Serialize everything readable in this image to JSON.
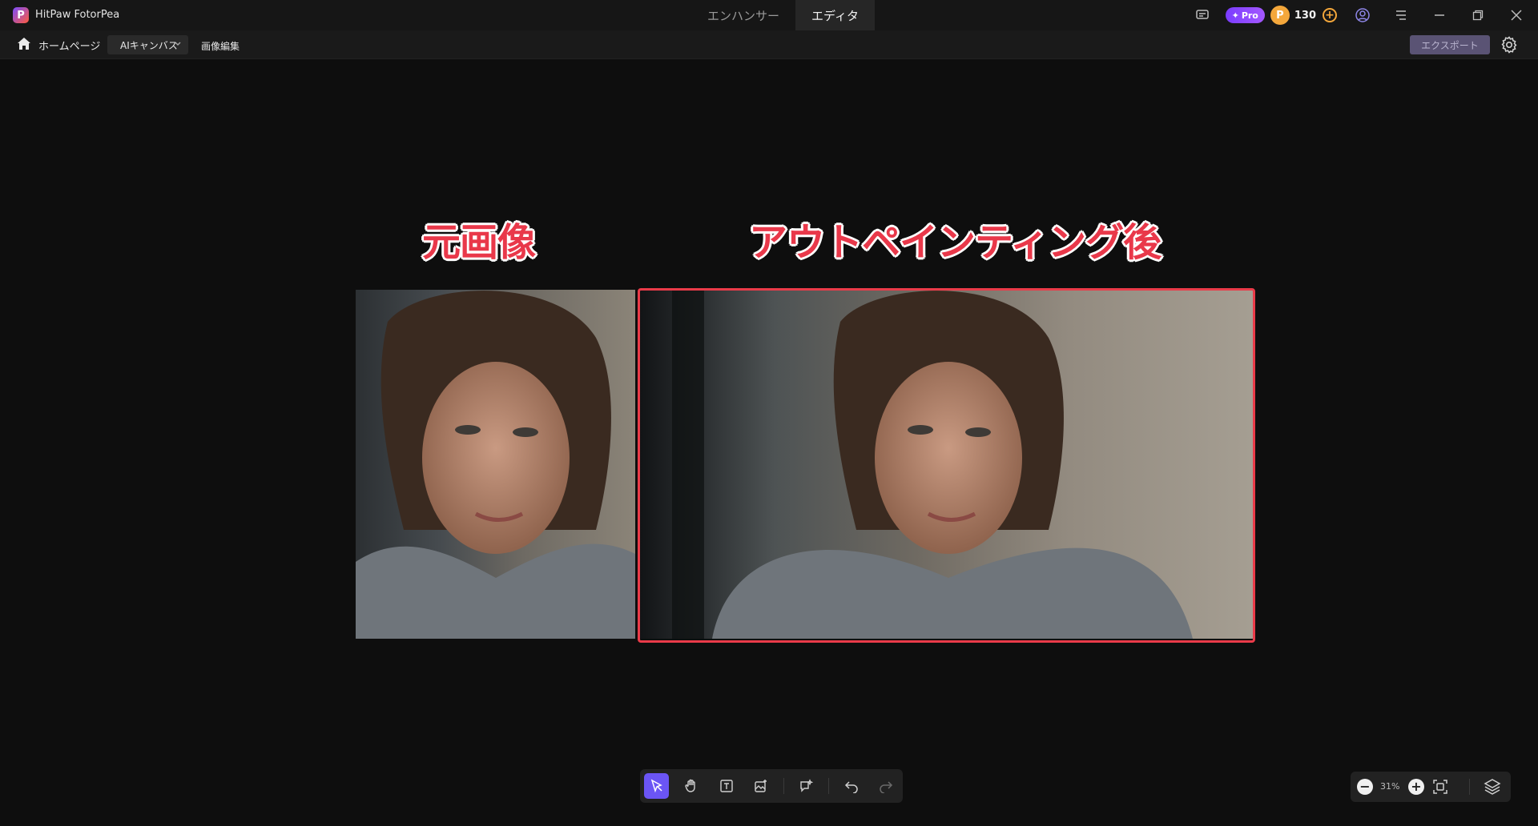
{
  "app": {
    "title": "HitPaw FotorPea",
    "logo_letter": "P"
  },
  "mode_tabs": [
    {
      "label": "エンハンサー",
      "active": false
    },
    {
      "label": "エディタ",
      "active": true
    }
  ],
  "titlebar": {
    "pro_label": "Pro",
    "coin_count": "130"
  },
  "toolbar": {
    "home_label": "ホームページ",
    "canvas_select_value": "AIキャンバス",
    "image_edit_label": "画像編集",
    "export_label": "エクスポート"
  },
  "canvas": {
    "label_original": "元画像",
    "label_after": "アウトペインティング後"
  },
  "zoom": {
    "value": "31%"
  },
  "colors": {
    "accent": "#6b55f5",
    "highlight_red": "#ea3b49",
    "pro_purple": "#8a45ff",
    "coin": "#f4a73b"
  },
  "icons": {
    "tools": [
      "select-arrow-icon",
      "hand-icon",
      "text-icon",
      "add-image-icon",
      "ai-chat-icon",
      "undo-icon",
      "redo-icon"
    ],
    "zoom": [
      "zoom-out-icon",
      "zoom-in-icon",
      "fit-screen-icon",
      "layers-icon"
    ]
  }
}
